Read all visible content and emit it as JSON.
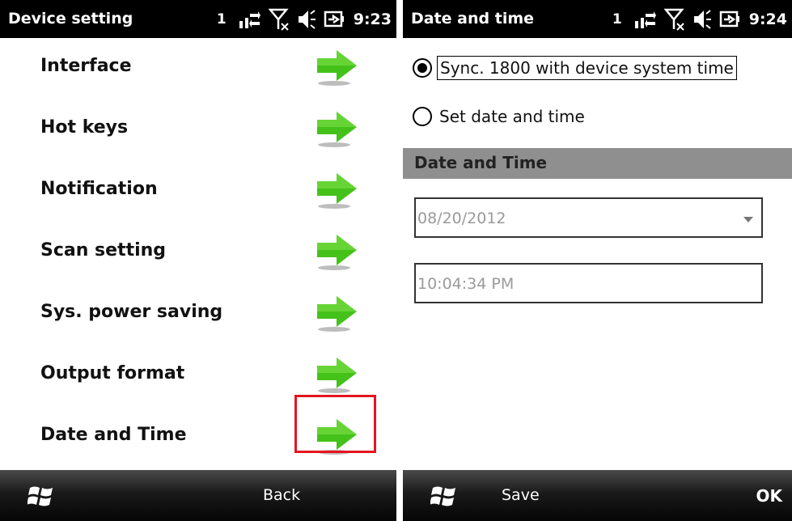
{
  "left": {
    "title": "Device setting",
    "status": {
      "signal": "1",
      "time": "9:23"
    },
    "menu_items": [
      {
        "label": "Interface"
      },
      {
        "label": "Hot keys"
      },
      {
        "label": "Notification"
      },
      {
        "label": "Scan setting"
      },
      {
        "label": "Sys. power saving"
      },
      {
        "label": "Output format"
      },
      {
        "label": "Date and Time"
      }
    ],
    "softbar": {
      "right_label": "Back"
    }
  },
  "right": {
    "title": "Date and time",
    "status": {
      "signal": "1",
      "time": "9:24"
    },
    "options": [
      {
        "label": "Sync. 1800 with device system time",
        "checked": true
      },
      {
        "label": "Set date and time",
        "checked": false
      }
    ],
    "section_header": "Date and Time",
    "date_value": "08/20/2012",
    "time_value": "10:04:34 PM",
    "softbar": {
      "left_label": "Save",
      "right_label": "OK"
    }
  },
  "colors": {
    "arrow_green": "#44c21a",
    "highlight_red": "#e4151f",
    "section_gray": "#8f8f8f"
  }
}
